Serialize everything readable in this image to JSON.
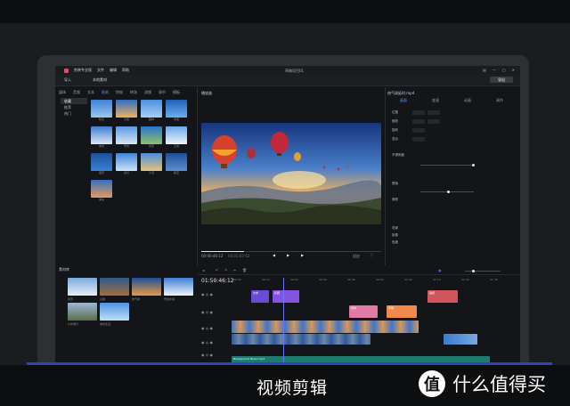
{
  "caption": "视频剪辑",
  "brand": {
    "logo": "值",
    "text": "什么值得买"
  },
  "app": {
    "title": "剪映专业版",
    "menu": [
      "菜单",
      "文件",
      "编辑",
      "帮助"
    ],
    "project_name": "草稿项目01",
    "toolbar_left": [
      "导入",
      "本地素材"
    ],
    "export_label": "导出"
  },
  "media_tabs": [
    "媒体",
    "音频",
    "文本",
    "贴纸",
    "特效",
    "转场",
    "滤镜",
    "调节",
    "模板"
  ],
  "media_active": "贴纸",
  "categories": [
    "收藏",
    "推荐",
    "热门"
  ],
  "thumb_labels": [
    "晴天",
    "日落",
    "森林",
    "海浪",
    "城市",
    "雪景",
    "草原",
    "云海",
    "夜景",
    "彩虹",
    "沙漠",
    "星空",
    "湖泊"
  ],
  "player": {
    "title": "播放器",
    "current": "00:00:46:12",
    "total": "00:01:07:02",
    "ratio": "适应"
  },
  "inspector": {
    "title": "热气球延时.mp4",
    "tabs": [
      "画面",
      "变速",
      "动画",
      "调节"
    ],
    "rows": [
      "位置",
      "缩放",
      "旋转",
      "混合",
      "不透明度",
      "蒙版",
      "美颜",
      "背景",
      "抠像",
      "色度"
    ]
  },
  "assets": {
    "title": "素材库",
    "labels": [
      "风景",
      "山脉",
      "热气球",
      "雪地冲浪",
      "户外旅行",
      "城市生活"
    ]
  },
  "timeline": {
    "timecode": "01:50:46:12",
    "ticks": [
      "00:00",
      "00:10",
      "00:20",
      "00:30",
      "00:40",
      "00:50",
      "01:00",
      "01:10",
      "01:20",
      "01:30"
    ],
    "clips": [
      "文本",
      "标题",
      "贴纸",
      "特效",
      "字幕",
      "Background Music.mp3"
    ]
  }
}
